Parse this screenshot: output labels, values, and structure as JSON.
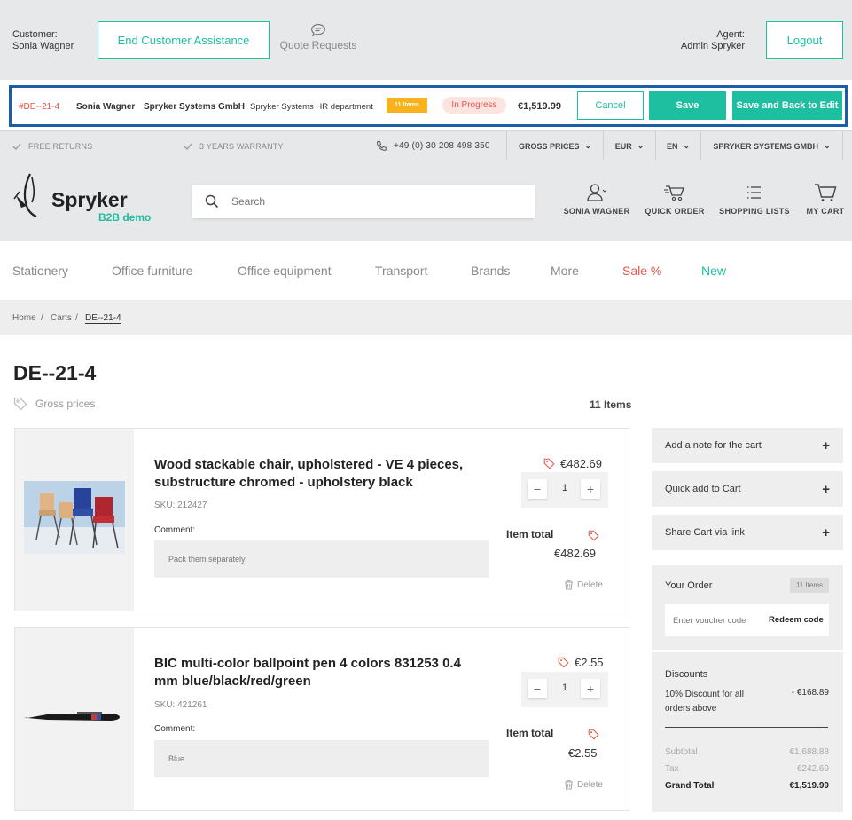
{
  "agent_bar": {
    "customer_label": "Customer:",
    "customer_name": "Sonia Wagner",
    "end_assistance": "End Customer Assistance",
    "quote_requests": "Quote Requests",
    "agent_label": "Agent:",
    "agent_name": "Admin Spryker",
    "logout": "Logout"
  },
  "quote_bar": {
    "quote_id": "#DE--21-4",
    "customer": "Sonia Wagner",
    "company": "Spryker Systems GmbH",
    "business_unit": "Spryker Systems HR department",
    "items_badge": "11 Items",
    "status": "In Progress",
    "total": "€1,519.99",
    "cancel": "Cancel",
    "save": "Save",
    "save_back": "Save and Back to Edit"
  },
  "info_strip": {
    "free_returns": "FREE RETURNS",
    "warranty": "3 YEARS WARRANTY",
    "phone": "+49 (0) 30 208 498 350",
    "price_mode": "GROSS PRICES",
    "currency": "EUR",
    "language": "EN",
    "company": "SPRYKER SYSTEMS GMBH"
  },
  "header": {
    "logo_name": "Spryker",
    "logo_sub": "B2B demo",
    "search_placeholder": "Search",
    "user": "SONIA WAGNER",
    "quick_order": "QUICK ORDER",
    "shopping_lists": "SHOPPING LISTS",
    "cart": "MY CART"
  },
  "nav": [
    "Stationery",
    "Office furniture",
    "Office equipment",
    "Transport",
    "Brands",
    "More",
    "Sale %",
    "New"
  ],
  "colors": {
    "accent": "#1ebea0",
    "sale": "#e2574c",
    "quote_border": "#1a5fa8",
    "badge_yellow": "#f7b21c"
  },
  "breadcrumb": {
    "home": "Home",
    "carts": "Carts",
    "current": "DE--21-4"
  },
  "page": {
    "title": "DE--21-4",
    "price_mode": "Gross prices",
    "item_count": "11 Items"
  },
  "items": [
    {
      "title": "Wood stackable chair, upholstered - VE 4 pieces, substructure chromed - upholstery black",
      "sku": "SKU: 212427",
      "comment_label": "Comment:",
      "comment": "Pack them separately",
      "price": "€482.69",
      "qty": "1",
      "total_label": "Item total",
      "total": "€482.69",
      "delete": "Delete"
    },
    {
      "title": "BIC multi-color ballpoint pen 4 colors 831253 0.4 mm blue/black/red/green",
      "sku": "SKU: 421261",
      "comment_label": "Comment:",
      "comment": "Blue",
      "price": "€2.55",
      "qty": "1",
      "total_label": "Item total",
      "total": "€2.55",
      "delete": "Delete"
    }
  ],
  "sidebar": {
    "add_note": "Add a note for the cart",
    "quick_add": "Quick add to Cart",
    "share": "Share Cart via link",
    "your_order": "Your Order",
    "items_badge": "11 Items",
    "voucher_placeholder": "Enter voucher code",
    "redeem": "Redeem code",
    "discounts": "Discounts",
    "discount_name": "10% Discount for all orders above",
    "discount_value": "- €168.89",
    "subtotal_label": "Subtotal",
    "subtotal": "€1,688.88",
    "tax_label": "Tax",
    "tax": "€242.69",
    "grand_label": "Grand Total",
    "grand": "€1,519.99"
  }
}
